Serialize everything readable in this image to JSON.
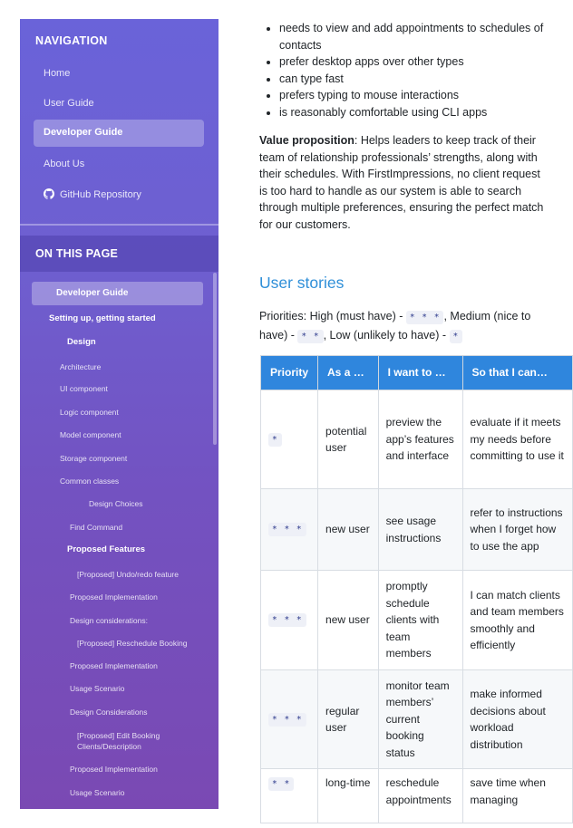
{
  "sidebar": {
    "nav_heading": "NAVIGATION",
    "nav_items": [
      "Home",
      "User Guide",
      "Developer Guide",
      "About Us",
      "GitHub Repository"
    ],
    "on_this_page_heading": "ON THIS PAGE",
    "toc": [
      "Developer Guide",
      "Setting up, getting started",
      "Design",
      "Architecture",
      "UI component",
      "Logic component",
      "Model component",
      "Storage component",
      "Common classes",
      "Design Choices",
      "Find Command",
      "Proposed Features",
      "[Proposed] Undo/redo feature",
      "Proposed Implementation",
      "Design considerations:",
      "[Proposed] Reschedule Booking",
      "Proposed Implementation",
      "Usage Scenario",
      "Design Considerations",
      "[Proposed] Edit Booking Clients/Description",
      "Proposed Implementation",
      "Usage Scenario"
    ]
  },
  "content": {
    "bullets": [
      "needs to view and add appointments to schedules of contacts",
      "prefer desktop apps over other types",
      "can type fast",
      "prefers typing to mouse interactions",
      "is reasonably comfortable using CLI apps"
    ],
    "value_prop_label": "Value proposition",
    "value_prop_text": ": Helps leaders to keep track of their team of relationship professionals’ strengths, along with their schedules. With FirstImpressions, no client request is too hard to handle as our system is able to search through multiple preferences, ensuring the perfect match for our customers.",
    "user_stories_heading": "User stories",
    "priorities_a": "Priorities: High (must have) - ",
    "priorities_high": "* * *",
    "priorities_b": ", Medium (nice to have) - ",
    "priorities_medium": "* *",
    "priorities_c": ", Low (unlikely to have) - ",
    "priorities_low": "*",
    "table_headers": [
      "Priority",
      "As a …",
      "I want to …",
      "So that I can…"
    ],
    "table_rows": [
      [
        "*",
        "potential user",
        "preview the app’s features and interface",
        "evaluate if it meets my needs before committing to use it"
      ],
      [
        "* * *",
        "new user",
        "see usage instructions",
        "refer to instructions when I forget how to use the app"
      ],
      [
        "* * *",
        "new user",
        "promptly schedule clients with team members",
        "I can match clients and team members smoothly and efficiently"
      ],
      [
        "* * *",
        "regular user",
        "monitor team members’ current booking status",
        "make informed decisions about workload distribution"
      ],
      [
        "* *",
        "long-time",
        "reschedule appointments",
        "save time when managing"
      ]
    ]
  }
}
